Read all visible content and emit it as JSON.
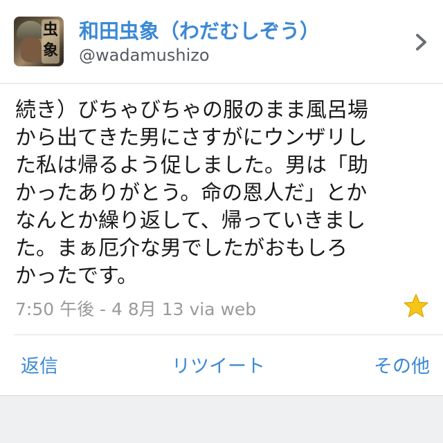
{
  "profile": {
    "display_name": "和田虫象（わだむしぞう）",
    "handle": "@wadamushizo",
    "avatar_ink": "虫象"
  },
  "tweet": {
    "lines": [
      "続き）びちゃびちゃの服のまま風呂場",
      "から出てきた男にさすがにウンザリし",
      "た私は帰るよう促しました。男は「助",
      "かったありがとう。命の恩人だ」とか",
      "なんとか繰り返して、帰っていきまし",
      "た。まぁ厄介な男でしたがおもしろ",
      "かったです。"
    ],
    "meta": "7:50 午後 - 4 8月 13 via web"
  },
  "actions": {
    "reply": "返信",
    "retweet": "リツイート",
    "other": "その他"
  },
  "colors": {
    "accent": "#3b89d6",
    "star": "#f5c518",
    "meta_text": "#9a9a9a"
  },
  "icons": [
    "chevron-right-icon",
    "star-icon"
  ]
}
